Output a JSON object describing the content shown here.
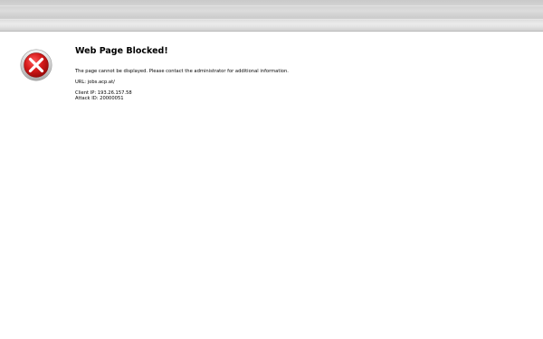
{
  "page": {
    "title": "Web Page Blocked!",
    "message": "The page cannot be displayed. Please contact the administrator for additional information.",
    "url_label": "URL:",
    "url_value": "jobs.acp.at/",
    "client_ip_label": "Client IP:",
    "client_ip_value": "193.26.157.58",
    "attack_id_label": "Attack ID:",
    "attack_id_value": "20000051"
  },
  "icons": {
    "status": "error-x-icon"
  },
  "colors": {
    "icon_red": "#d11717",
    "icon_ring": "#c8c8c8",
    "banner": "#d6d6d6"
  }
}
